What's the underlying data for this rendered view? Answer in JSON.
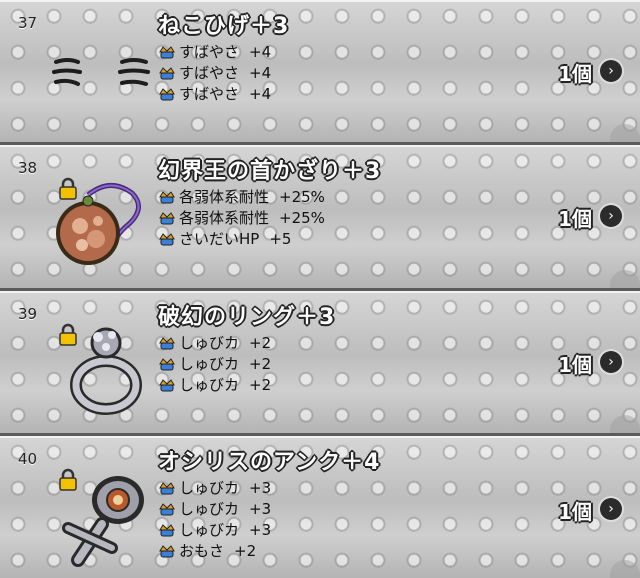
{
  "items": [
    {
      "num": "37",
      "name": "ねこひげ＋3",
      "stats": [
        {
          "label": "すばやさ",
          "value": "+4"
        },
        {
          "label": "すばやさ",
          "value": "+4"
        },
        {
          "label": "すばやさ",
          "value": "+4"
        }
      ],
      "count": "1個",
      "icon": "cat-whiskers-icon",
      "locked": false
    },
    {
      "num": "38",
      "name": "幻界王の首かざり＋3",
      "stats": [
        {
          "label": "各弱体系耐性",
          "value": "+25%"
        },
        {
          "label": "各弱体系耐性",
          "value": "+25%"
        },
        {
          "label": "さいだいHP",
          "value": "+5"
        }
      ],
      "count": "1個",
      "icon": "necklace-icon",
      "locked": true
    },
    {
      "num": "39",
      "name": "破幻のリング＋3",
      "stats": [
        {
          "label": "しゅびカ",
          "value": "+2"
        },
        {
          "label": "しゅびカ",
          "value": "+2"
        },
        {
          "label": "しゅびカ",
          "value": "+2"
        }
      ],
      "count": "1個",
      "icon": "ring-icon",
      "locked": true
    },
    {
      "num": "40",
      "name": "オシリスのアンク＋4",
      "stats": [
        {
          "label": "しゅびカ",
          "value": "+3"
        },
        {
          "label": "しゅびカ",
          "value": "+3"
        },
        {
          "label": "しゅびカ",
          "value": "+3"
        },
        {
          "label": "おもさ",
          "value": "+2"
        }
      ],
      "count": "1個",
      "icon": "ankh-icon",
      "locked": true
    }
  ],
  "colors": {
    "stat_icon_crown": "#e0a020",
    "stat_icon_gem": "#3a7fd8",
    "lock": "#f2c200"
  }
}
